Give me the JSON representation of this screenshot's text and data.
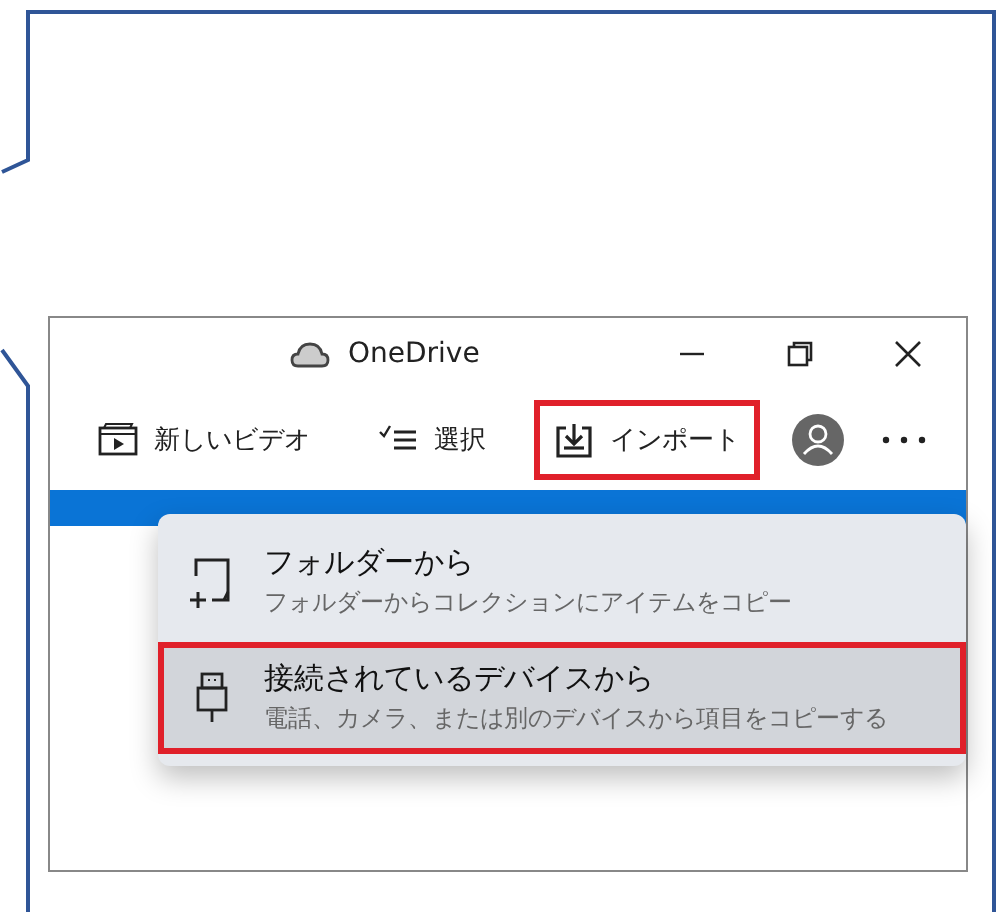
{
  "window": {
    "title": "OneDrive"
  },
  "toolbar": [
    {
      "kind": "video",
      "label": "新しいビデオ",
      "highlighted": false
    },
    {
      "kind": "select",
      "label": "選択",
      "highlighted": false
    },
    {
      "kind": "import",
      "label": "インポート",
      "highlighted": true
    }
  ],
  "menu": [
    {
      "kind": "folder",
      "title": "フォルダーから",
      "subtitle": "フォルダーからコレクションにアイテムをコピー",
      "selected": false,
      "highlighted": false
    },
    {
      "kind": "device",
      "title": "接続されているデバイスから",
      "subtitle": "電話、カメラ、または別のデバイスから項目をコピーする",
      "selected": true,
      "highlighted": true
    }
  ]
}
